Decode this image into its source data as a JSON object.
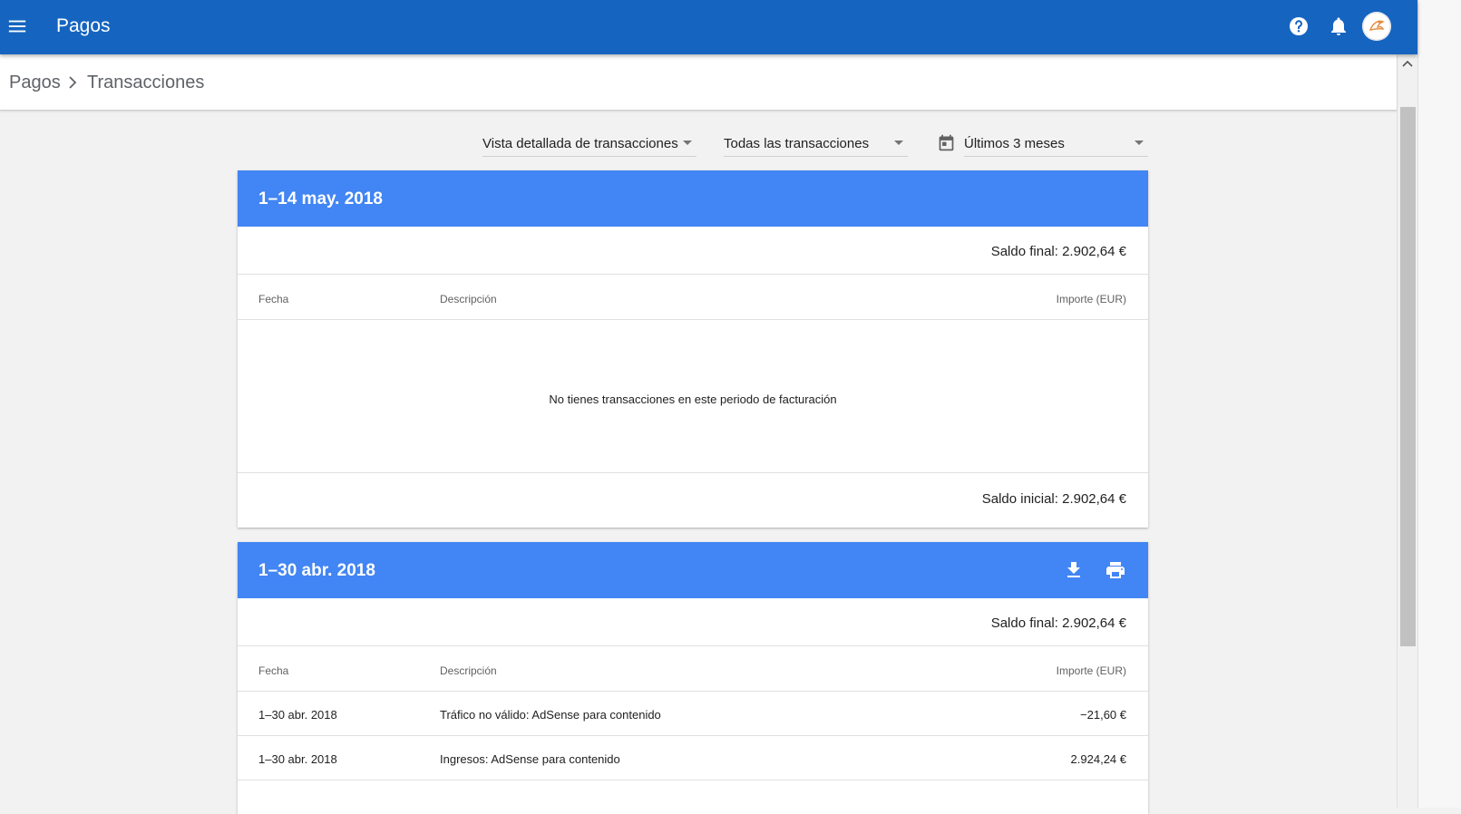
{
  "app": {
    "title": "Pagos"
  },
  "breadcrumb": {
    "items": [
      "Pagos",
      "Transacciones"
    ]
  },
  "filters": {
    "view": "Vista detallada de transacciones",
    "type": "Todas las transacciones",
    "range": "Últimos 3 meses"
  },
  "periods": [
    {
      "title": "1–14 may. 2018",
      "final_balance": "Saldo final: 2.902,64 €",
      "columns": {
        "date": "Fecha",
        "description": "Descripción",
        "amount": "Importe (EUR)"
      },
      "empty_message": "No tienes transacciones en este periodo de facturación",
      "initial_balance": "Saldo inicial: 2.902,64 €"
    },
    {
      "title": "1–30 abr. 2018",
      "final_balance": "Saldo final: 2.902,64 €",
      "columns": {
        "date": "Fecha",
        "description": "Descripción",
        "amount": "Importe (EUR)"
      },
      "rows": [
        {
          "date": "1–30 abr. 2018",
          "description": "Tráfico no válido: AdSense para contenido",
          "amount": "−21,60 €"
        },
        {
          "date": "1–30 abr. 2018",
          "description": "Ingresos: AdSense para contenido",
          "amount": "2.924,24 €"
        }
      ]
    }
  ],
  "colors": {
    "topbar": "#1565c0",
    "card_header": "#4285f4"
  },
  "icons": [
    "menu-icon",
    "help-icon",
    "bell-icon",
    "avatar",
    "chevron-right-icon",
    "calendar-icon",
    "download-icon",
    "print-icon"
  ]
}
